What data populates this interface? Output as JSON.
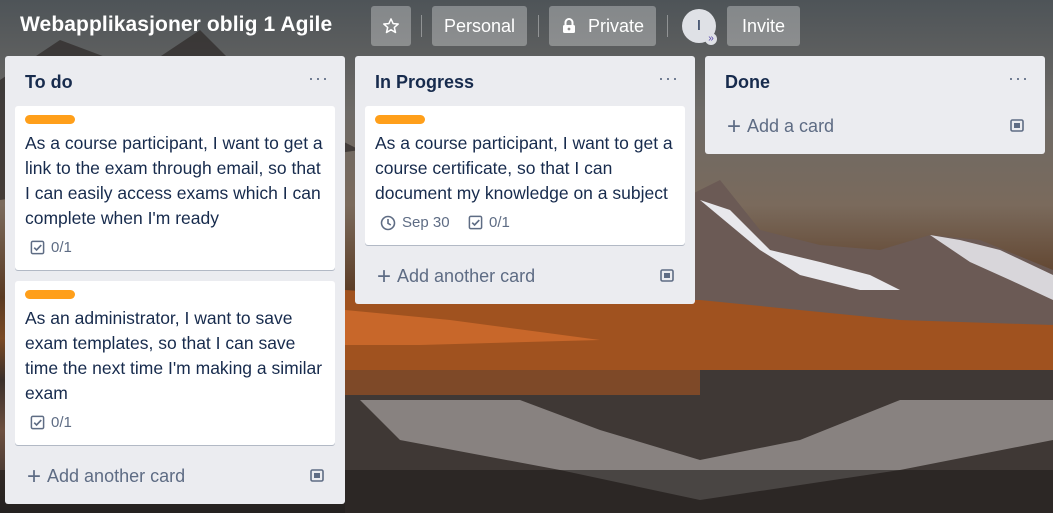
{
  "board": {
    "title": "Webapplikasjoner oblig 1 Agile",
    "star_icon": "star-icon",
    "workspace_label": "Personal",
    "visibility_label": "Private",
    "visibility_icon": "lock-icon",
    "member_initial": "I",
    "invite_label": "Invite"
  },
  "lists": [
    {
      "title": "To do",
      "menu": "···",
      "cards": [
        {
          "label_color": "#ff9f1a",
          "text": "As a course participant, I want to get a link to the exam through email, so that I can easily access exams which I can complete when I'm ready",
          "checklist": "0/1"
        },
        {
          "label_color": "#ff9f1a",
          "text": "As an administrator, I want to save exam templates, so that I can save time the next time I'm making a similar exam",
          "checklist": "0/1"
        }
      ],
      "add_label": "Add another card"
    },
    {
      "title": "In Progress",
      "menu": "···",
      "cards": [
        {
          "label_color": "#ff9f1a",
          "text": "As a course participant, I want to get a course certificate, so that I can document my knowledge on a subject",
          "due": "Sep 30",
          "checklist": "0/1"
        }
      ],
      "add_label": "Add another card"
    },
    {
      "title": "Done",
      "menu": "···",
      "cards": [],
      "add_label": "Add a card"
    }
  ]
}
